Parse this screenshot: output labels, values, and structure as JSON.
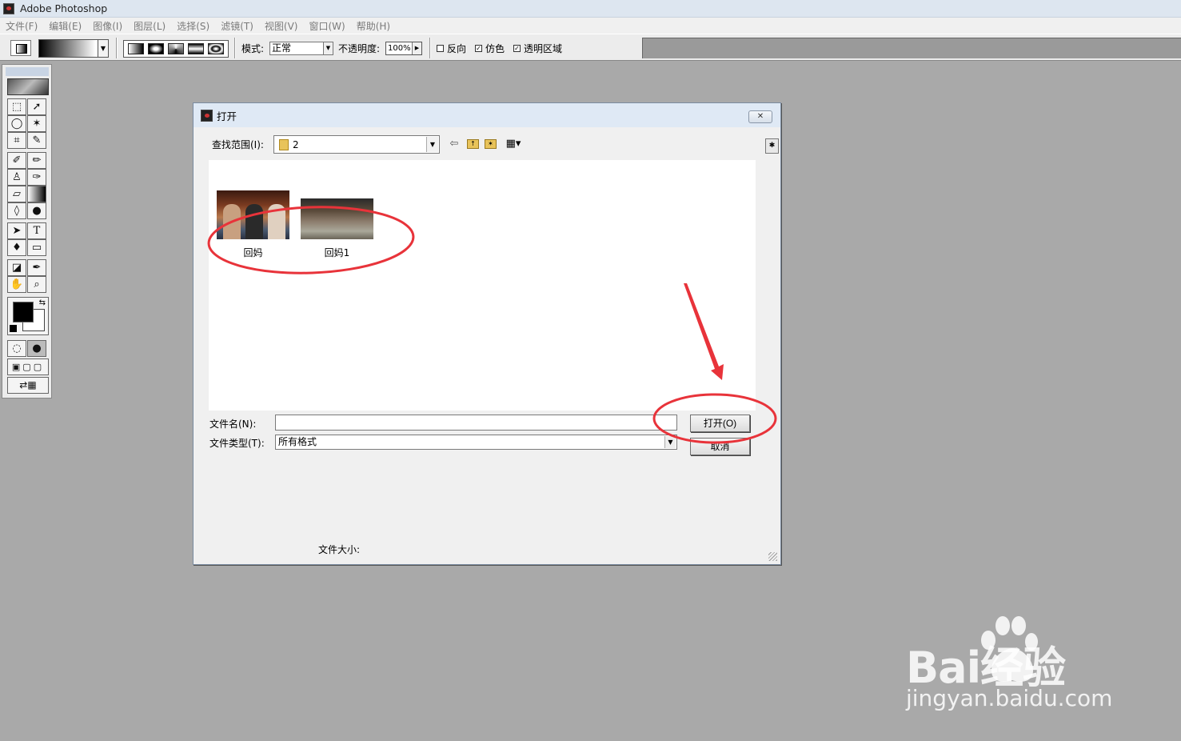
{
  "app": {
    "title": "Adobe Photoshop"
  },
  "menu": [
    "文件(F)",
    "编辑(E)",
    "图像(I)",
    "图层(L)",
    "选择(S)",
    "滤镜(T)",
    "视图(V)",
    "窗口(W)",
    "帮助(H)"
  ],
  "options": {
    "mode_label": "模式:",
    "mode_value": "正常",
    "opacity_label": "不透明度:",
    "opacity_value": "100%",
    "reverse_label": "反向",
    "dither_label": "仿色",
    "transparency_label": "透明区域",
    "reverse_checked": false,
    "dither_checked": true,
    "transparency_checked": true
  },
  "dialog": {
    "title": "打开",
    "close_glyph": "✕",
    "look_in_label": "查找范围(I):",
    "look_in_value": "2",
    "files": [
      {
        "name": "回妈"
      },
      {
        "name": "回妈1"
      }
    ],
    "filename_label": "文件名(N):",
    "filename_value": "",
    "filetype_label": "文件类型(T):",
    "filetype_value": "所有格式",
    "open_button": "打开(O)",
    "cancel_button": "取消",
    "filesize_label": "文件大小:"
  },
  "watermark": {
    "text": "Bai经验",
    "url": "jingyan.baidu.com"
  },
  "colors": {
    "annotation": "#e8333a",
    "foreground": "#000000",
    "background": "#ffffff"
  }
}
